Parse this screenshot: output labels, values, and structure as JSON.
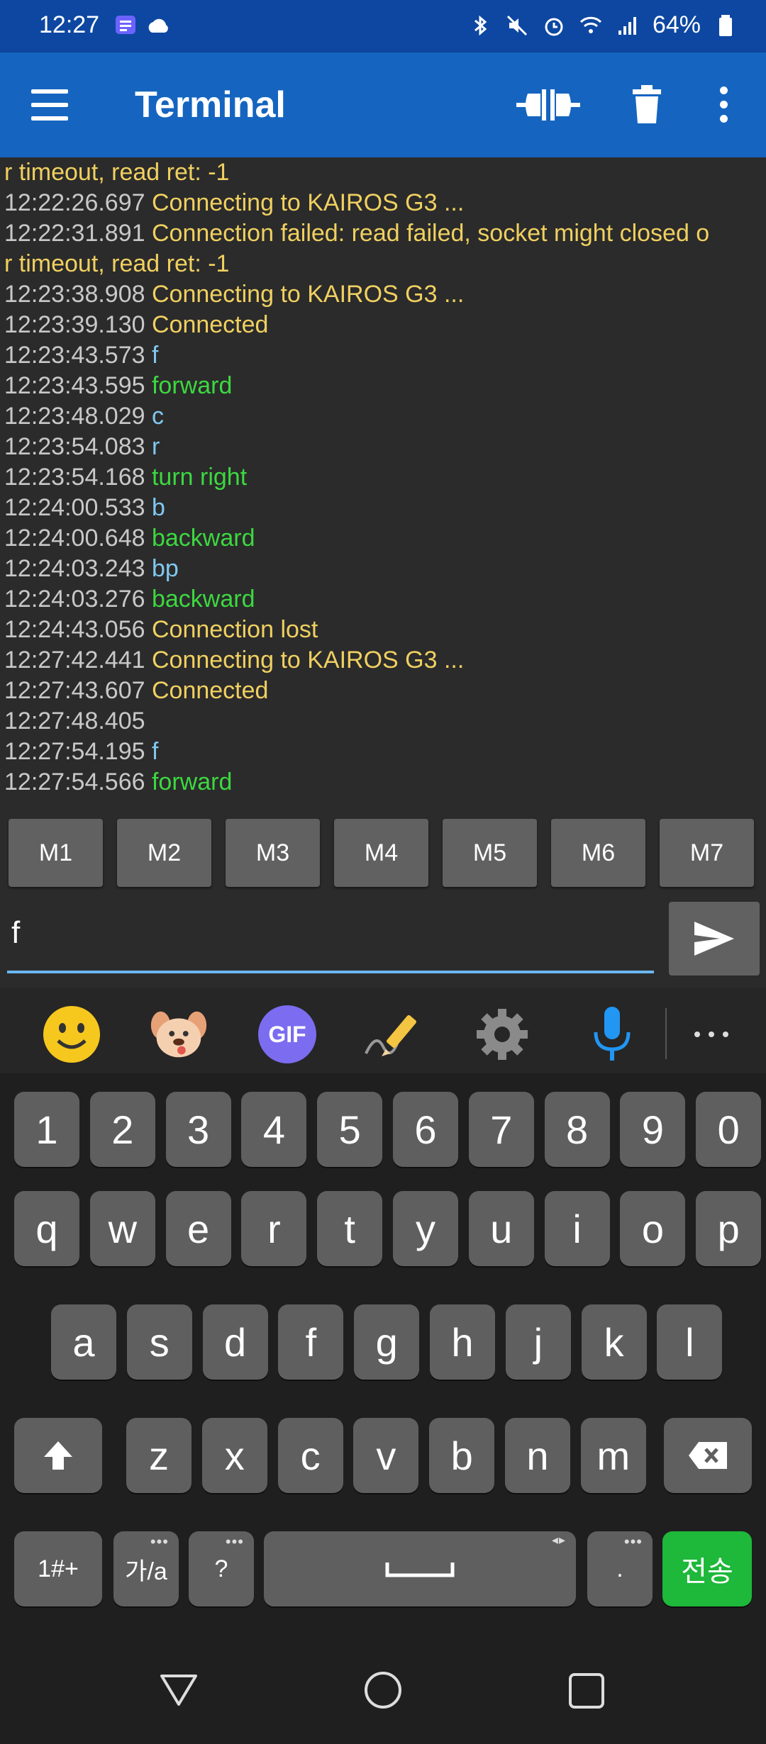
{
  "status_bar": {
    "time": "12:27",
    "battery": "64%"
  },
  "app_bar": {
    "title": "Terminal",
    "icons": [
      "menu-icon",
      "connect-icon",
      "delete-icon",
      "more-vert-icon"
    ]
  },
  "log": [
    {
      "time": "",
      "text": "r timeout, read ret: -1",
      "kind": "status"
    },
    {
      "time": "12:22:26.697",
      "text": "Connecting to KAIROS G3 ...",
      "kind": "status"
    },
    {
      "time": "12:22:31.891",
      "text": "Connection failed: read failed, socket might closed o",
      "kind": "status"
    },
    {
      "time": "",
      "text": "r timeout, read ret: -1",
      "kind": "status"
    },
    {
      "time": "12:23:38.908",
      "text": "Connecting to KAIROS G3 ...",
      "kind": "status"
    },
    {
      "time": "12:23:39.130",
      "text": "Connected",
      "kind": "status"
    },
    {
      "time": "12:23:43.573",
      "text": "f",
      "kind": "sent"
    },
    {
      "time": "12:23:43.595",
      "text": "forward",
      "kind": "recv"
    },
    {
      "time": "12:23:48.029",
      "text": "c",
      "kind": "sent"
    },
    {
      "time": "12:23:54.083",
      "text": "r",
      "kind": "sent"
    },
    {
      "time": "12:23:54.168",
      "text": "turn right",
      "kind": "recv"
    },
    {
      "time": "12:24:00.533",
      "text": "b",
      "kind": "sent"
    },
    {
      "time": "12:24:00.648",
      "text": "backward",
      "kind": "recv"
    },
    {
      "time": "12:24:03.243",
      "text": "bp",
      "kind": "sent"
    },
    {
      "time": "12:24:03.276",
      "text": "backward",
      "kind": "recv"
    },
    {
      "time": "12:24:43.056",
      "text": "Connection lost",
      "kind": "status"
    },
    {
      "time": "12:27:42.441",
      "text": "Connecting to KAIROS G3 ...",
      "kind": "status"
    },
    {
      "time": "12:27:43.607",
      "text": "Connected",
      "kind": "status"
    },
    {
      "time": "12:27:48.405",
      "text": "",
      "kind": "sent"
    },
    {
      "time": "12:27:54.195",
      "text": "f",
      "kind": "sent"
    },
    {
      "time": "12:27:54.566",
      "text": "forward",
      "kind": "recv"
    }
  ],
  "macros": [
    "M1",
    "M2",
    "M3",
    "M4",
    "M5",
    "M6",
    "M7"
  ],
  "input": {
    "value": "f"
  },
  "keyboard": {
    "toolbar_icons": [
      "emoji-icon",
      "sticker-icon",
      "gif-icon",
      "handwriting-icon",
      "settings-icon",
      "microphone-icon",
      "more-icon"
    ],
    "gif_label": "GIF",
    "row_numbers": [
      "1",
      "2",
      "3",
      "4",
      "5",
      "6",
      "7",
      "8",
      "9",
      "0"
    ],
    "row_top": [
      "q",
      "w",
      "e",
      "r",
      "t",
      "y",
      "u",
      "i",
      "o",
      "p"
    ],
    "row_middle": [
      "a",
      "s",
      "d",
      "f",
      "g",
      "h",
      "j",
      "k",
      "l"
    ],
    "row_bottom": [
      "z",
      "x",
      "c",
      "v",
      "b",
      "n",
      "m"
    ],
    "symbols_key": "1#+",
    "language_key": "가/a",
    "question_key": "?",
    "period_key": ".",
    "enter_key": "전송"
  },
  "colors": {
    "status_text": "#f0d060",
    "sent_text": "#80c8f0",
    "recv_text": "#3cd840",
    "app_bar": "#1565c0",
    "enter_key": "#1eb83a"
  },
  "nav_bar": {
    "icons": [
      "back-icon",
      "home-icon",
      "recents-icon"
    ]
  }
}
